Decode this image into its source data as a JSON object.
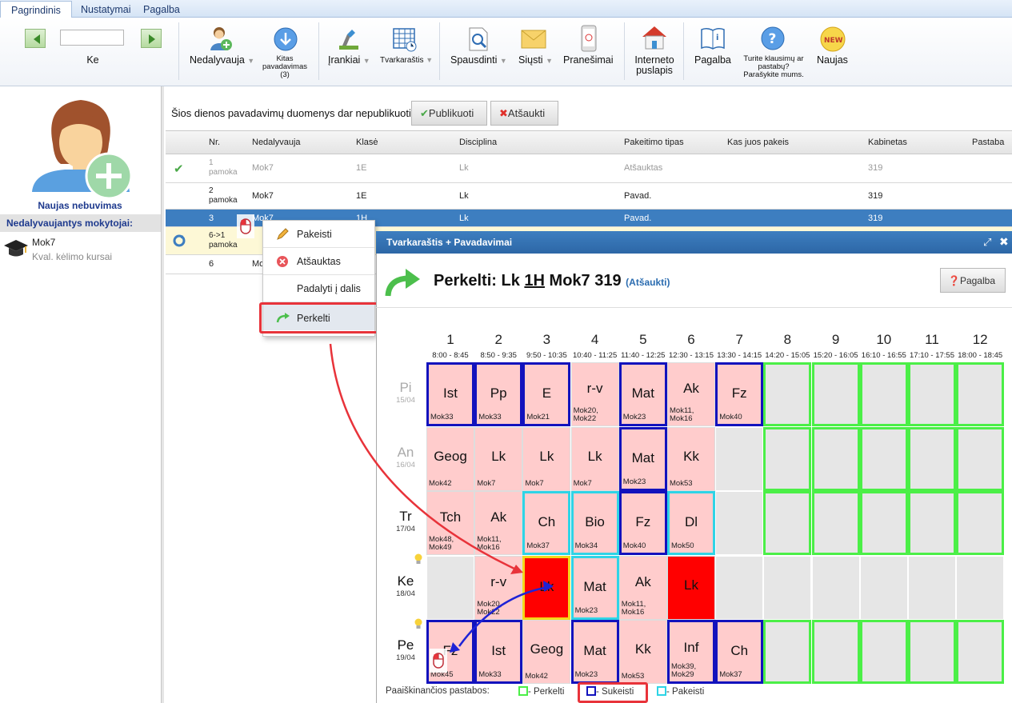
{
  "tabs": [
    "Pagrindinis",
    "Nustatymai",
    "Pagalba"
  ],
  "ribbon": {
    "day_label": "Ke",
    "absent_label": "Nedalyvauja",
    "other_subs_label": "Kitas pavadavimas (3)",
    "tools_label": "Įrankiai",
    "timetable_label": "Tvarkaraštis",
    "print_label": "Spausdinti",
    "send_label": "Siųsti",
    "messages_label": "Pranešimai",
    "website_label": "Interneto puslapis",
    "help_label": "Pagalba",
    "feedback_label": "Turite klausimų ar pastabų? Parašykite mums.",
    "new_label": "Naujas",
    "new_badge": "NEW"
  },
  "left": {
    "new_absence_label": "Naujas nebuvimas",
    "section_title": "Nedalyvaujantys mokytojai:",
    "teacher_name": "Mok7",
    "teacher_note": "Kval. kėlimo kursai"
  },
  "main": {
    "notice": "Šios dienos pavadavimų duomenys dar nepublikuoti.",
    "publish_label": "Publikuoti",
    "cancel_label": "Atšaukti",
    "columns": [
      "Nr.",
      "Nedalyvauja",
      "Klasė",
      "Disciplina",
      "Pakeitimo tipas",
      "Kas juos pakeis",
      "Kabinetas",
      "Pastaba"
    ],
    "rows": [
      {
        "nr": "1\npamoka",
        "absent": "Mok7",
        "class": "1E",
        "subject": "Lk",
        "type": "Atšauktas",
        "who": "",
        "room": "319"
      },
      {
        "nr": "2\npamoka",
        "absent": "Mok7",
        "class": "1E",
        "subject": "Lk",
        "type": "Pavad.",
        "who": "",
        "room": "319"
      },
      {
        "nr": "3",
        "absent": "Mok7",
        "class": "1H",
        "subject": "Lk",
        "type": "Pavad.",
        "who": "",
        "room": "319"
      },
      {
        "nr": "6->1\npamoka",
        "absent": "",
        "class": "",
        "subject": "",
        "type": "",
        "who": "",
        "room": ""
      },
      {
        "nr": "6",
        "absent": "Mo",
        "class": "",
        "subject": "",
        "type": "",
        "who": "",
        "room": ""
      }
    ]
  },
  "context_menu": {
    "items": [
      "Pakeisti",
      "Atšauktas",
      "Padalyti į dalis",
      "Perkelti"
    ]
  },
  "dialog": {
    "title": "Tvarkaraštis + Pavadavimai",
    "heading_prefix": "Perkelti: Lk",
    "heading_class": "1H",
    "heading_suffix": "Mok7 319",
    "heading_link": "(Atšaukti)",
    "help_label": "Pagalba",
    "periods": [
      "1",
      "2",
      "3",
      "4",
      "5",
      "6",
      "7",
      "8",
      "9",
      "10",
      "11",
      "12"
    ],
    "times": [
      "8:00 - 8:45",
      "8:50 - 9:35",
      "9:50 - 10:35",
      "10:40 - 11:25",
      "11:40 - 12:25",
      "12:30 - 13:15",
      "13:30 - 14:15",
      "14:20 - 15:05",
      "15:20 - 16:05",
      "16:10 - 16:55",
      "17:10 - 17:55",
      "18:00 - 18:45"
    ],
    "days": [
      {
        "name": "Pi",
        "date": "15/04",
        "past": true
      },
      {
        "name": "An",
        "date": "16/04",
        "past": true
      },
      {
        "name": "Tr",
        "date": "17/04",
        "past": false
      },
      {
        "name": "Ke",
        "date": "18/04",
        "past": false
      },
      {
        "name": "Pe",
        "date": "19/04",
        "past": false
      }
    ],
    "grid": [
      [
        {
          "s": "Ist",
          "t": "Mok33",
          "bg": "pink",
          "b": "blue"
        },
        {
          "s": "Pp",
          "t": "Mok33",
          "bg": "pink",
          "b": "blue"
        },
        {
          "s": "E",
          "t": "Mok21",
          "bg": "pink",
          "b": "blue"
        },
        {
          "s": "r-v",
          "t": "Mok20,\nMok22",
          "bg": "pink",
          "b": ""
        },
        {
          "s": "Mat",
          "t": "Mok23",
          "bg": "pink",
          "b": "blue"
        },
        {
          "s": "Ak",
          "t": "Mok11,\nMok16",
          "bg": "pink",
          "b": ""
        },
        {
          "s": "Fz",
          "t": "Mok40",
          "bg": "pink",
          "b": "blue"
        },
        {
          "s": "",
          "t": "",
          "bg": "gray",
          "b": "green"
        },
        {
          "s": "",
          "t": "",
          "bg": "gray",
          "b": "green"
        },
        {
          "s": "",
          "t": "",
          "bg": "gray",
          "b": "green"
        },
        {
          "s": "",
          "t": "",
          "bg": "gray",
          "b": "green"
        },
        {
          "s": "",
          "t": "",
          "bg": "gray",
          "b": "green"
        }
      ],
      [
        {
          "s": "Geog",
          "t": "Mok42",
          "bg": "pink",
          "b": ""
        },
        {
          "s": "Lk",
          "t": "Mok7",
          "bg": "pink",
          "b": ""
        },
        {
          "s": "Lk",
          "t": "Mok7",
          "bg": "pink",
          "b": ""
        },
        {
          "s": "Lk",
          "t": "Mok7",
          "bg": "pink",
          "b": ""
        },
        {
          "s": "Mat",
          "t": "Mok23",
          "bg": "pink",
          "b": "blue"
        },
        {
          "s": "Kk",
          "t": "Mok53",
          "bg": "pink",
          "b": ""
        },
        {
          "s": "",
          "t": "",
          "bg": "gray",
          "b": ""
        },
        {
          "s": "",
          "t": "",
          "bg": "gray",
          "b": "green"
        },
        {
          "s": "",
          "t": "",
          "bg": "gray",
          "b": "green"
        },
        {
          "s": "",
          "t": "",
          "bg": "gray",
          "b": "green"
        },
        {
          "s": "",
          "t": "",
          "bg": "gray",
          "b": "green"
        },
        {
          "s": "",
          "t": "",
          "bg": "gray",
          "b": "green"
        }
      ],
      [
        {
          "s": "Tch",
          "t": "Mok48,\nMok49",
          "bg": "pink",
          "b": ""
        },
        {
          "s": "Ak",
          "t": "Mok11,\nMok16",
          "bg": "pink",
          "b": ""
        },
        {
          "s": "Ch",
          "t": "Mok37",
          "bg": "pink",
          "b": "cyan"
        },
        {
          "s": "Bio",
          "t": "Mok34",
          "bg": "pink",
          "b": "cyan"
        },
        {
          "s": "Fz",
          "t": "Mok40",
          "bg": "pink",
          "b": "blue"
        },
        {
          "s": "Dl",
          "t": "Mok50",
          "bg": "pink",
          "b": "cyan"
        },
        {
          "s": "",
          "t": "",
          "bg": "gray",
          "b": ""
        },
        {
          "s": "",
          "t": "",
          "bg": "gray",
          "b": "green"
        },
        {
          "s": "",
          "t": "",
          "bg": "gray",
          "b": "green"
        },
        {
          "s": "",
          "t": "",
          "bg": "gray",
          "b": "green"
        },
        {
          "s": "",
          "t": "",
          "bg": "gray",
          "b": "green"
        },
        {
          "s": "",
          "t": "",
          "bg": "gray",
          "b": "green"
        }
      ],
      [
        {
          "s": "",
          "t": "",
          "bg": "gray",
          "b": ""
        },
        {
          "s": "r-v",
          "t": "Mok20,\nMok22",
          "bg": "pink",
          "b": ""
        },
        {
          "s": "Lk",
          "t": "",
          "bg": "red",
          "b": "yellow"
        },
        {
          "s": "Mat",
          "t": "Mok23",
          "bg": "pink",
          "b": "cyan"
        },
        {
          "s": "Ak",
          "t": "Mok11,\nMok16",
          "bg": "pink",
          "b": ""
        },
        {
          "s": "Lk",
          "t": "",
          "bg": "red",
          "b": ""
        },
        {
          "s": "",
          "t": "",
          "bg": "gray",
          "b": ""
        },
        {
          "s": "",
          "t": "",
          "bg": "gray",
          "b": ""
        },
        {
          "s": "",
          "t": "",
          "bg": "gray",
          "b": ""
        },
        {
          "s": "",
          "t": "",
          "bg": "gray",
          "b": ""
        },
        {
          "s": "",
          "t": "",
          "bg": "gray",
          "b": ""
        },
        {
          "s": "",
          "t": "",
          "bg": "gray",
          "b": ""
        }
      ],
      [
        {
          "s": "Fz",
          "t": "Mok45",
          "bg": "pink",
          "b": "blue"
        },
        {
          "s": "Ist",
          "t": "Mok33",
          "bg": "pink",
          "b": "blue"
        },
        {
          "s": "Geog",
          "t": "Mok42",
          "bg": "pink",
          "b": ""
        },
        {
          "s": "Mat",
          "t": "Mok23",
          "bg": "pink",
          "b": "blue"
        },
        {
          "s": "Kk",
          "t": "Mok53",
          "bg": "pink",
          "b": ""
        },
        {
          "s": "Inf",
          "t": "Mok39,\nMok29",
          "bg": "pink",
          "b": "blue"
        },
        {
          "s": "Ch",
          "t": "Mok37",
          "bg": "pink",
          "b": "blue"
        },
        {
          "s": "",
          "t": "",
          "bg": "gray",
          "b": "green"
        },
        {
          "s": "",
          "t": "",
          "bg": "gray",
          "b": "green"
        },
        {
          "s": "",
          "t": "",
          "bg": "gray",
          "b": "green"
        },
        {
          "s": "",
          "t": "",
          "bg": "gray",
          "b": "green"
        },
        {
          "s": "",
          "t": "",
          "bg": "gray",
          "b": "green"
        }
      ]
    ],
    "legend": {
      "title": "Paaiškinančios pastabos:",
      "moved": "- Perkelti",
      "swapped": "- Sukeisti",
      "changed": "- Pakeisti"
    }
  },
  "colors": {
    "accent": "#2d67a6",
    "swap_border": "#1212bd",
    "move_border": "#4bef47",
    "change_border": "#2ed4e6",
    "highlight": "#e8333a"
  }
}
